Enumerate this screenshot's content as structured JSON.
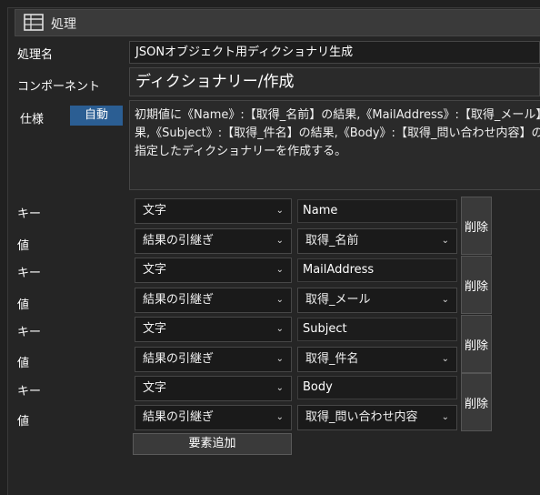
{
  "window": {
    "title": "処理",
    "title_icon": "table-icon"
  },
  "form": {
    "process_name_label": "処理名",
    "process_name_value": "JSONオブジェクト用ディクショナリ生成",
    "component_label": "コンポーネント",
    "component_value": "ディクショナリー/作成",
    "spec_label": "仕様",
    "auto_button": "自動",
    "spec_lines": [
      "初期値に《Name》:【取得_名前】の結果,《MailAddress》:【取得_メール】の結",
      "果,《Subject》:【取得_件名】の結果,《Body》:【取得_問い合わせ内容】の結果",
      "指定したディクショナリーを作成する。"
    ]
  },
  "entries": [
    {
      "key_label": "キー",
      "key_type": "文字",
      "key_value": "Name",
      "value_label": "値",
      "value_type": "結果の引継ぎ",
      "value_value": "取得_名前",
      "delete": "削除"
    },
    {
      "key_label": "キー",
      "key_type": "文字",
      "key_value": "MailAddress",
      "value_label": "値",
      "value_type": "結果の引継ぎ",
      "value_value": "取得_メール",
      "delete": "削除"
    },
    {
      "key_label": "キー",
      "key_type": "文字",
      "key_value": "Subject",
      "value_label": "値",
      "value_type": "結果の引継ぎ",
      "value_value": "取得_件名",
      "delete": "削除"
    },
    {
      "key_label": "キー",
      "key_type": "文字",
      "key_value": "Body",
      "value_label": "値",
      "value_type": "結果の引継ぎ",
      "value_value": "取得_問い合わせ内容",
      "delete": "削除"
    }
  ],
  "add_button": "要素追加",
  "colors": {
    "background": "#202020",
    "accent": "#2b5e93",
    "field": "#1a1a1a"
  }
}
